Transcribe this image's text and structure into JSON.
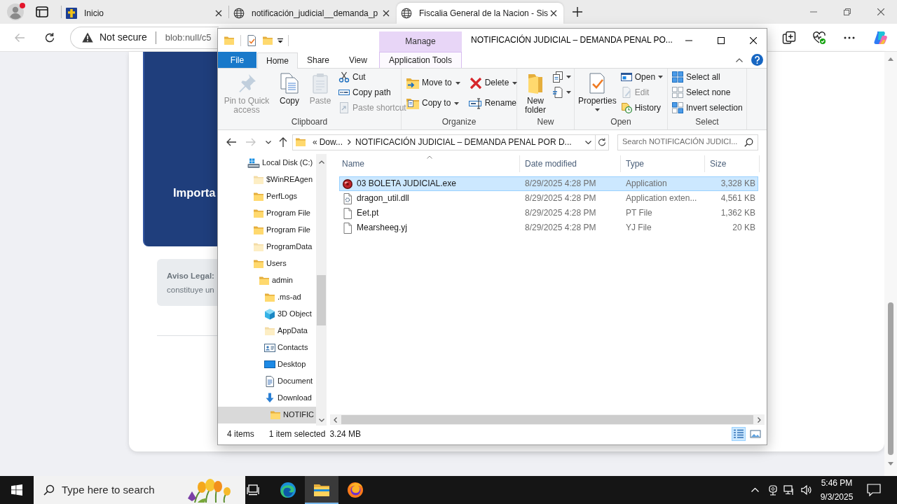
{
  "browser": {
    "tabs": [
      {
        "title": "Inicio",
        "kind": "emblem",
        "selected": false
      },
      {
        "title": "notificación_judicial__demanda_p",
        "kind": "globe",
        "selected": false
      },
      {
        "title": "Fiscalia General de la Nacion - Sis",
        "kind": "globe",
        "selected": true
      }
    ],
    "back_disabled": true,
    "address": {
      "security": "Not secure",
      "url": "blob:null/c5"
    }
  },
  "page": {
    "banner_text": "Importa",
    "notice_title": "Aviso Legal:",
    "notice_text": "constituye un"
  },
  "explorer": {
    "context_group": "Manage",
    "title": "NOTIFICACIÓN JUDICIAL – DEMANDA PENAL PO...",
    "ribbon_tabs": [
      {
        "label": "File",
        "kind": "file",
        "selected": false
      },
      {
        "label": "Home",
        "kind": "tab",
        "selected": true
      },
      {
        "label": "Share",
        "kind": "tab",
        "selected": false
      },
      {
        "label": "View",
        "kind": "tab",
        "selected": false
      },
      {
        "label": "Application Tools",
        "kind": "context",
        "selected": false
      }
    ],
    "ribbon_groups": [
      {
        "label": "Clipboard",
        "columns": [
          [
            {
              "label": "Pin to Quick access",
              "kind": "large",
              "disabled": true,
              "dropdown": false
            }
          ],
          [
            {
              "label": "Copy",
              "kind": "large",
              "disabled": false,
              "dropdown": false
            }
          ],
          [
            {
              "label": "Paste",
              "kind": "large",
              "disabled": true,
              "dropdown": false
            }
          ],
          [
            {
              "label": "Cut",
              "kind": "small",
              "disabled": false,
              "dropdown": false
            },
            {
              "label": "Copy path",
              "kind": "small",
              "disabled": false,
              "dropdown": false
            },
            {
              "label": "Paste shortcut",
              "kind": "small",
              "disabled": true,
              "dropdown": false
            }
          ]
        ]
      },
      {
        "label": "Organize",
        "columns": [
          [
            {
              "label": "Move to",
              "kind": "medium",
              "disabled": false,
              "dropdown": true
            },
            {
              "label": "Copy to",
              "kind": "medium",
              "disabled": false,
              "dropdown": true
            }
          ],
          [
            {
              "label": "Delete",
              "kind": "medium",
              "disabled": false,
              "dropdown": true
            },
            {
              "label": "Rename",
              "kind": "medium",
              "disabled": false,
              "dropdown": false
            }
          ]
        ]
      },
      {
        "label": "New",
        "columns": [
          [
            {
              "label": "New folder",
              "kind": "large",
              "disabled": false,
              "dropdown": false
            }
          ],
          [
            {
              "kind": "small",
              "disabled": false,
              "dropdown": true
            },
            {
              "kind": "small",
              "disabled": false,
              "dropdown": true
            }
          ]
        ]
      },
      {
        "label": "Open",
        "columns": [
          [
            {
              "label": "Properties",
              "kind": "large",
              "disabled": false,
              "dropdown": true
            }
          ],
          [
            {
              "label": "Open",
              "kind": "small",
              "disabled": false,
              "dropdown": true
            },
            {
              "label": "Edit",
              "kind": "small",
              "disabled": true,
              "dropdown": false
            },
            {
              "label": "History",
              "kind": "small",
              "disabled": false,
              "dropdown": false
            }
          ]
        ]
      },
      {
        "label": "Select",
        "columns": [
          [
            {
              "label": "Select all",
              "kind": "small",
              "disabled": false,
              "dropdown": false
            },
            {
              "label": "Select none",
              "kind": "small",
              "disabled": false,
              "dropdown": false
            },
            {
              "label": "Invert selection",
              "kind": "small",
              "disabled": false,
              "dropdown": false
            }
          ]
        ]
      }
    ],
    "nav_buttons": [
      {
        "disabled": false
      },
      {
        "disabled": true
      },
      {
        "disabled": false
      },
      {
        "disabled": false
      }
    ],
    "address": {
      "overflow": "«",
      "crumbs": [
        "Dow...",
        "NOTIFICACIÓN JUDICIAL – DEMANDA PENAL POR D..."
      ]
    },
    "search": {
      "placeholder": "Search NOTIFICACIÓN JUDICI..."
    },
    "tree": [
      {
        "label": "Local Disk (C:)",
        "kind": "drive",
        "selected": false,
        "children": [
          {
            "label": "$WinREAgen",
            "kind": "hidden",
            "selected": false
          },
          {
            "label": "PerfLogs",
            "kind": "folder",
            "selected": false
          },
          {
            "label": "Program File",
            "kind": "folder",
            "selected": false
          },
          {
            "label": "Program File",
            "kind": "folder",
            "selected": false
          },
          {
            "label": "ProgramData",
            "kind": "hidden",
            "selected": false
          },
          {
            "label": "Users",
            "kind": "folder",
            "selected": false,
            "children": [
              {
                "label": "admin",
                "kind": "folder",
                "selected": false,
                "children": [
                  {
                    "label": ".ms-ad",
                    "kind": "folder",
                    "selected": false
                  },
                  {
                    "label": "3D Object",
                    "kind": "objects",
                    "selected": false
                  },
                  {
                    "label": "AppData",
                    "kind": "hidden",
                    "selected": false
                  },
                  {
                    "label": "Contacts",
                    "kind": "contacts",
                    "selected": false
                  },
                  {
                    "label": "Desktop",
                    "kind": "desktop",
                    "selected": false
                  },
                  {
                    "label": "Document",
                    "kind": "documents",
                    "selected": false
                  },
                  {
                    "label": "Download",
                    "kind": "downloads",
                    "selected": false,
                    "children": [
                      {
                        "label": "NOTIFIC",
                        "kind": "folder",
                        "selected": true
                      }
                    ]
                  }
                ]
              }
            ]
          }
        ]
      }
    ],
    "columns": [
      {
        "label": "Name",
        "sorted": true
      },
      {
        "label": "Date modified",
        "sorted": false
      },
      {
        "label": "Type",
        "sorted": false
      },
      {
        "label": "Size",
        "sorted": false
      }
    ],
    "files": [
      {
        "name": "03 BOLETA JUDICIAL.exe",
        "date": "8/29/2025 4:28 PM",
        "type": "Application",
        "size": "3,328 KB",
        "kind": "application",
        "selected": true
      },
      {
        "name": "dragon_util.dll",
        "date": "8/29/2025 4:28 PM",
        "type": "Application exten...",
        "size": "4,561 KB",
        "kind": "extension",
        "selected": false
      },
      {
        "name": "Eet.pt",
        "date": "8/29/2025 4:28 PM",
        "type": "PT File",
        "size": "1,362 KB",
        "kind": "file",
        "selected": false
      },
      {
        "name": "Mearsheeg.yj",
        "date": "8/29/2025 4:28 PM",
        "type": "YJ File",
        "size": "20 KB",
        "kind": "file",
        "selected": false
      }
    ],
    "status": {
      "count": "4 items",
      "selection": "1 item selected",
      "size": "3.24 MB"
    },
    "view_buttons": [
      {
        "selected": true
      },
      {
        "selected": false
      }
    ]
  },
  "taskbar": {
    "search_placeholder": "Type here to search",
    "apps": [
      {
        "kind": "task-view",
        "active": false
      },
      {
        "kind": "browser",
        "active": false
      },
      {
        "kind": "explorer",
        "active": true
      },
      {
        "kind": "firefox",
        "active": false
      }
    ],
    "time": "5:46 PM",
    "date": "9/3/2025"
  }
}
